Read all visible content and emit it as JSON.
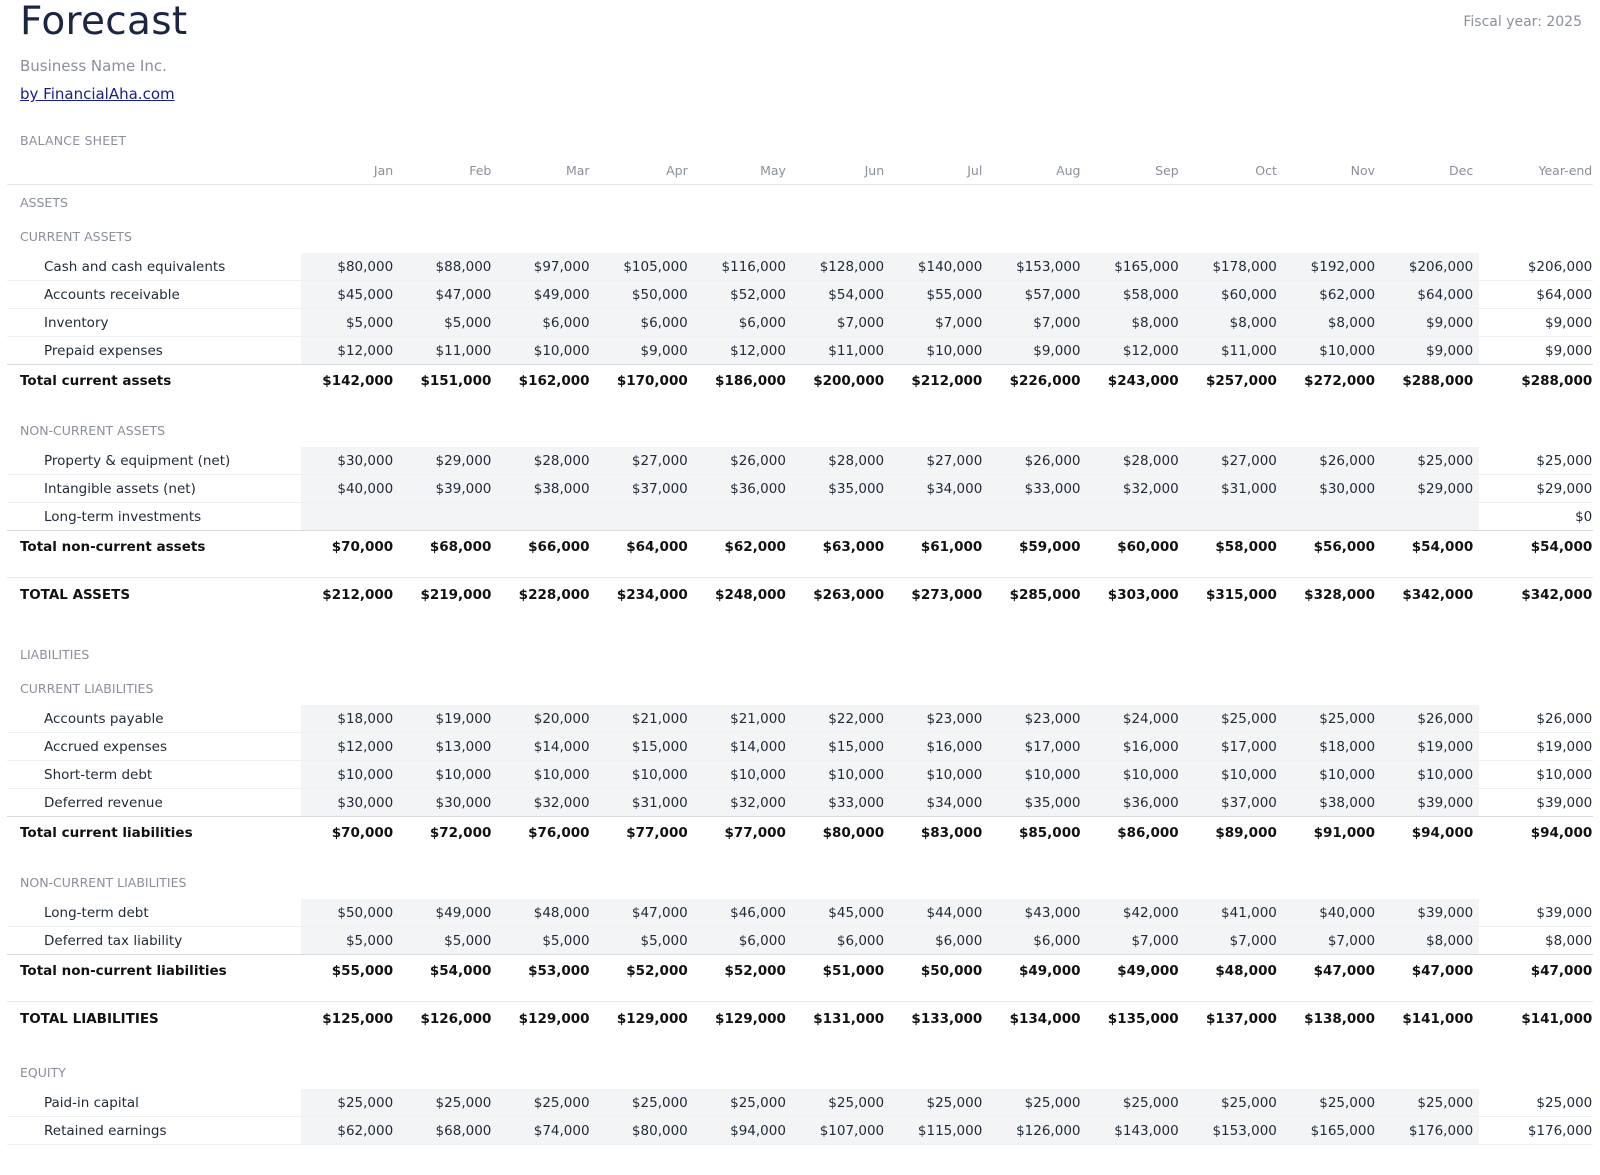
{
  "header": {
    "title": "Forecast",
    "fiscal_year": "Fiscal year: 2025",
    "company": "Business Name Inc.",
    "link": "by FinancialAha.com"
  },
  "sheet_label": "BALANCE SHEET",
  "months": [
    "Jan",
    "Feb",
    "Mar",
    "Apr",
    "May",
    "Jun",
    "Jul",
    "Aug",
    "Sep",
    "Oct",
    "Nov",
    "Dec"
  ],
  "year_end_label": "Year-end",
  "blocks": [
    {
      "type": "section",
      "label": "ASSETS"
    },
    {
      "type": "section",
      "label": "CURRENT ASSETS"
    },
    {
      "type": "item",
      "label": "Cash and cash equivalents",
      "values": [
        "$80,000",
        "$88,000",
        "$97,000",
        "$105,000",
        "$116,000",
        "$128,000",
        "$140,000",
        "$153,000",
        "$165,000",
        "$178,000",
        "$192,000",
        "$206,000"
      ],
      "year_end": "$206,000"
    },
    {
      "type": "item",
      "label": "Accounts receivable",
      "values": [
        "$45,000",
        "$47,000",
        "$49,000",
        "$50,000",
        "$52,000",
        "$54,000",
        "$55,000",
        "$57,000",
        "$58,000",
        "$60,000",
        "$62,000",
        "$64,000"
      ],
      "year_end": "$64,000"
    },
    {
      "type": "item",
      "label": "Inventory",
      "values": [
        "$5,000",
        "$5,000",
        "$6,000",
        "$6,000",
        "$6,000",
        "$7,000",
        "$7,000",
        "$7,000",
        "$8,000",
        "$8,000",
        "$8,000",
        "$9,000"
      ],
      "year_end": "$9,000"
    },
    {
      "type": "item",
      "label": "Prepaid expenses",
      "values": [
        "$12,000",
        "$11,000",
        "$10,000",
        "$9,000",
        "$12,000",
        "$11,000",
        "$10,000",
        "$9,000",
        "$12,000",
        "$11,000",
        "$10,000",
        "$9,000"
      ],
      "year_end": "$9,000",
      "last": true
    },
    {
      "type": "total",
      "label": "Total current assets",
      "values": [
        "$142,000",
        "$151,000",
        "$162,000",
        "$170,000",
        "$186,000",
        "$200,000",
        "$212,000",
        "$226,000",
        "$243,000",
        "$257,000",
        "$272,000",
        "$288,000"
      ],
      "year_end": "$288,000"
    },
    {
      "type": "gap"
    },
    {
      "type": "section",
      "label": "NON-CURRENT ASSETS"
    },
    {
      "type": "item",
      "label": "Property & equipment (net)",
      "values": [
        "$30,000",
        "$29,000",
        "$28,000",
        "$27,000",
        "$26,000",
        "$28,000",
        "$27,000",
        "$26,000",
        "$28,000",
        "$27,000",
        "$26,000",
        "$25,000"
      ],
      "year_end": "$25,000"
    },
    {
      "type": "item",
      "label": "Intangible assets (net)",
      "values": [
        "$40,000",
        "$39,000",
        "$38,000",
        "$37,000",
        "$36,000",
        "$35,000",
        "$34,000",
        "$33,000",
        "$32,000",
        "$31,000",
        "$30,000",
        "$29,000"
      ],
      "year_end": "$29,000"
    },
    {
      "type": "item",
      "label": "Long-term investments",
      "values": [
        "",
        "",
        "",
        "",
        "",
        "",
        "",
        "",
        "",
        "",
        "",
        ""
      ],
      "year_end": "$0",
      "last": true
    },
    {
      "type": "total",
      "label": "Total non-current assets",
      "values": [
        "$70,000",
        "$68,000",
        "$66,000",
        "$64,000",
        "$62,000",
        "$63,000",
        "$61,000",
        "$59,000",
        "$60,000",
        "$58,000",
        "$56,000",
        "$54,000"
      ],
      "year_end": "$54,000"
    },
    {
      "type": "gapsmall"
    },
    {
      "type": "grand",
      "label": "TOTAL ASSETS",
      "values": [
        "$212,000",
        "$219,000",
        "$228,000",
        "$234,000",
        "$248,000",
        "$263,000",
        "$273,000",
        "$285,000",
        "$303,000",
        "$315,000",
        "$328,000",
        "$342,000"
      ],
      "year_end": "$342,000"
    },
    {
      "type": "gapbig"
    },
    {
      "type": "section",
      "label": "LIABILITIES"
    },
    {
      "type": "section",
      "label": "CURRENT LIABILITIES"
    },
    {
      "type": "item",
      "label": "Accounts payable",
      "values": [
        "$18,000",
        "$19,000",
        "$20,000",
        "$21,000",
        "$21,000",
        "$22,000",
        "$23,000",
        "$23,000",
        "$24,000",
        "$25,000",
        "$25,000",
        "$26,000"
      ],
      "year_end": "$26,000"
    },
    {
      "type": "item",
      "label": "Accrued expenses",
      "values": [
        "$12,000",
        "$13,000",
        "$14,000",
        "$15,000",
        "$14,000",
        "$15,000",
        "$16,000",
        "$17,000",
        "$16,000",
        "$17,000",
        "$18,000",
        "$19,000"
      ],
      "year_end": "$19,000"
    },
    {
      "type": "item",
      "label": "Short-term debt",
      "values": [
        "$10,000",
        "$10,000",
        "$10,000",
        "$10,000",
        "$10,000",
        "$10,000",
        "$10,000",
        "$10,000",
        "$10,000",
        "$10,000",
        "$10,000",
        "$10,000"
      ],
      "year_end": "$10,000"
    },
    {
      "type": "item",
      "label": "Deferred revenue",
      "values": [
        "$30,000",
        "$30,000",
        "$32,000",
        "$31,000",
        "$32,000",
        "$33,000",
        "$34,000",
        "$35,000",
        "$36,000",
        "$37,000",
        "$38,000",
        "$39,000"
      ],
      "year_end": "$39,000",
      "last": true
    },
    {
      "type": "total",
      "label": "Total current liabilities",
      "values": [
        "$70,000",
        "$72,000",
        "$76,000",
        "$77,000",
        "$77,000",
        "$80,000",
        "$83,000",
        "$85,000",
        "$86,000",
        "$89,000",
        "$91,000",
        "$94,000"
      ],
      "year_end": "$94,000"
    },
    {
      "type": "gap"
    },
    {
      "type": "section",
      "label": "NON-CURRENT LIABILITIES"
    },
    {
      "type": "item",
      "label": "Long-term debt",
      "values": [
        "$50,000",
        "$49,000",
        "$48,000",
        "$47,000",
        "$46,000",
        "$45,000",
        "$44,000",
        "$43,000",
        "$42,000",
        "$41,000",
        "$40,000",
        "$39,000"
      ],
      "year_end": "$39,000"
    },
    {
      "type": "item",
      "label": "Deferred tax liability",
      "values": [
        "$5,000",
        "$5,000",
        "$5,000",
        "$5,000",
        "$6,000",
        "$6,000",
        "$6,000",
        "$6,000",
        "$7,000",
        "$7,000",
        "$7,000",
        "$8,000"
      ],
      "year_end": "$8,000",
      "last": true
    },
    {
      "type": "total",
      "label": "Total non-current liabilities",
      "values": [
        "$55,000",
        "$54,000",
        "$53,000",
        "$52,000",
        "$52,000",
        "$51,000",
        "$50,000",
        "$49,000",
        "$49,000",
        "$48,000",
        "$47,000",
        "$47,000"
      ],
      "year_end": "$47,000"
    },
    {
      "type": "gapsmall"
    },
    {
      "type": "grand",
      "label": "TOTAL LIABILITIES",
      "values": [
        "$125,000",
        "$126,000",
        "$129,000",
        "$129,000",
        "$129,000",
        "$131,000",
        "$133,000",
        "$134,000",
        "$135,000",
        "$137,000",
        "$138,000",
        "$141,000"
      ],
      "year_end": "$141,000"
    },
    {
      "type": "gapmid"
    },
    {
      "type": "section",
      "label": "EQUITY"
    },
    {
      "type": "item",
      "label": "Paid-in capital",
      "values": [
        "$25,000",
        "$25,000",
        "$25,000",
        "$25,000",
        "$25,000",
        "$25,000",
        "$25,000",
        "$25,000",
        "$25,000",
        "$25,000",
        "$25,000",
        "$25,000"
      ],
      "year_end": "$25,000"
    },
    {
      "type": "item",
      "label": "Retained earnings",
      "values": [
        "$62,000",
        "$68,000",
        "$74,000",
        "$80,000",
        "$94,000",
        "$107,000",
        "$115,000",
        "$126,000",
        "$143,000",
        "$153,000",
        "$165,000",
        "$176,000"
      ],
      "year_end": "$176,000"
    }
  ]
}
